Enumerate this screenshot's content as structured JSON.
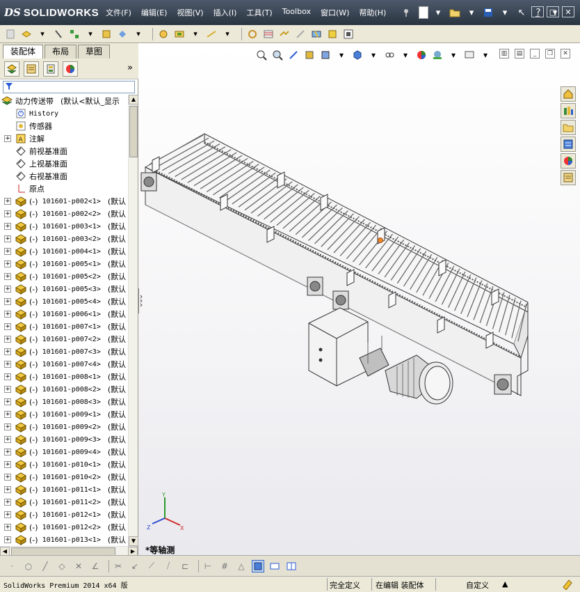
{
  "app": {
    "logo_prefix": "DS",
    "logo_text": "SOLIDWORKS"
  },
  "menu": [
    "文件(F)",
    "编辑(E)",
    "视图(V)",
    "插入(I)",
    "工具(T)",
    "Toolbox",
    "窗口(W)",
    "帮助(H)"
  ],
  "title_tools": {
    "help": "?"
  },
  "panel": {
    "tabs": [
      "装配体",
      "布局",
      "草图"
    ],
    "more": "»"
  },
  "tree": {
    "root": {
      "label": "动力传送带",
      "config": "(默认<默认_显示"
    },
    "special": [
      {
        "label": "History",
        "icon": "history-icon",
        "mono": true
      },
      {
        "label": "传感器",
        "icon": "sensor-icon"
      },
      {
        "label": "注解",
        "icon": "annotation-icon",
        "expandable": true
      },
      {
        "label": "前视基准面",
        "icon": "plane-icon"
      },
      {
        "label": "上视基准面",
        "icon": "plane-icon"
      },
      {
        "label": "右视基准面",
        "icon": "plane-icon"
      },
      {
        "label": "原点",
        "icon": "origin-icon"
      }
    ],
    "parts": [
      {
        "state": "(-)",
        "name": "101601-p002<1>",
        "config": "(默认"
      },
      {
        "state": "(-)",
        "name": "101601-p002<2>",
        "config": "(默认"
      },
      {
        "state": "(-)",
        "name": "101601-p003<1>",
        "config": "(默认"
      },
      {
        "state": "(-)",
        "name": "101601-p003<2>",
        "config": "(默认"
      },
      {
        "state": "(-)",
        "name": "101601-p004<1>",
        "config": "(默认"
      },
      {
        "state": "(-)",
        "name": "101601-p005<1>",
        "config": "(默认"
      },
      {
        "state": "(-)",
        "name": "101601-p005<2>",
        "config": "(默认"
      },
      {
        "state": "(-)",
        "name": "101601-p005<3>",
        "config": "(默认"
      },
      {
        "state": "(-)",
        "name": "101601-p005<4>",
        "config": "(默认"
      },
      {
        "state": "(-)",
        "name": "101601-p006<1>",
        "config": "(默认"
      },
      {
        "state": "(-)",
        "name": "101601-p007<1>",
        "config": "(默认"
      },
      {
        "state": "(-)",
        "name": "101601-p007<2>",
        "config": "(默认"
      },
      {
        "state": "(-)",
        "name": "101601-p007<3>",
        "config": "(默认"
      },
      {
        "state": "(-)",
        "name": "101601-p007<4>",
        "config": "(默认"
      },
      {
        "state": "(-)",
        "name": "101601-p008<1>",
        "config": "(默认"
      },
      {
        "state": "(-)",
        "name": "101601-p008<2>",
        "config": "(默认"
      },
      {
        "state": "(-)",
        "name": "101601-p008<3>",
        "config": "(默认"
      },
      {
        "state": "(-)",
        "name": "101601-p009<1>",
        "config": "(默认"
      },
      {
        "state": "(-)",
        "name": "101601-p009<2>",
        "config": "(默认"
      },
      {
        "state": "(-)",
        "name": "101601-p009<3>",
        "config": "(默认"
      },
      {
        "state": "(-)",
        "name": "101601-p009<4>",
        "config": "(默认"
      },
      {
        "state": "(-)",
        "name": "101601-p010<1>",
        "config": "(默认"
      },
      {
        "state": "(-)",
        "name": "101601-p010<2>",
        "config": "(默认"
      },
      {
        "state": "(-)",
        "name": "101601-p011<1>",
        "config": "(默认"
      },
      {
        "state": "(-)",
        "name": "101601-p011<2>",
        "config": "(默认"
      },
      {
        "state": "(-)",
        "name": "101601-p012<1>",
        "config": "(默认"
      },
      {
        "state": "(-)",
        "name": "101601-p012<2>",
        "config": "(默认"
      },
      {
        "state": "(-)",
        "name": "101601-p013<1>",
        "config": "(默认"
      }
    ]
  },
  "graphics": {
    "view_name": "*等轴测",
    "triad": {
      "x": "X",
      "y": "Y",
      "z": "Z"
    }
  },
  "status": {
    "app": "SolidWorks Premium 2014 x64 版",
    "definition": "完全定义",
    "editing": "在编辑 装配体",
    "units": "自定义",
    "caret": "▲"
  },
  "colors": {
    "accent": "#316ac5",
    "title_bg": "#3a4555",
    "model_line": "#3a3a3a",
    "highlight": "#f08a2a"
  }
}
